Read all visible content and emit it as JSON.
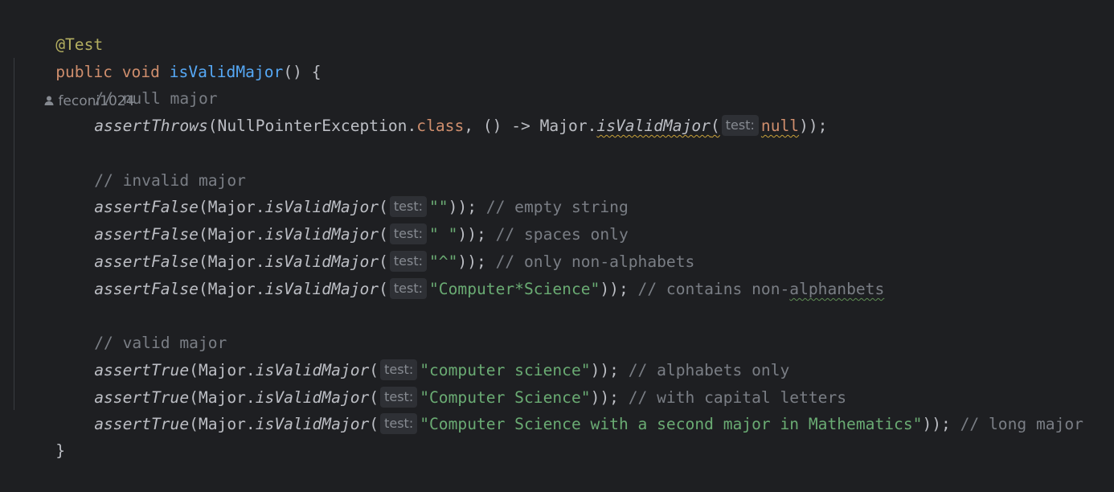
{
  "header": {
    "annotation": "@Test",
    "author": "feconi1024"
  },
  "method": {
    "keyword_public": "public",
    "keyword_void": "void",
    "name": "isValidMajor",
    "params_open": "() {",
    "close_brace": "}"
  },
  "hint_label": "test:",
  "comments": {
    "null_major": "// null major",
    "invalid_major": "// invalid major",
    "valid_major": "// valid major"
  },
  "lines": {
    "throws": {
      "assert": "assertThrows",
      "open": "(NullPointerException.",
      "class_kw": "class",
      "mid": ", () -> Major.",
      "call": "isValidMajor",
      "paren": "(",
      "arg": "null",
      "close": "));"
    },
    "invalid": [
      {
        "assert": "assertFalse",
        "pre": "(Major.",
        "call": "isValidMajor",
        "paren": "(",
        "arg": "\"\"",
        "close": "));",
        "comment": "// empty string"
      },
      {
        "assert": "assertFalse",
        "pre": "(Major.",
        "call": "isValidMajor",
        "paren": "(",
        "arg": "\" \"",
        "close": "));",
        "comment": "// spaces only"
      },
      {
        "assert": "assertFalse",
        "pre": "(Major.",
        "call": "isValidMajor",
        "paren": "(",
        "arg": "\"^\"",
        "close": "));",
        "comment": "// only non-alphabets"
      },
      {
        "assert": "assertFalse",
        "pre": "(Major.",
        "call": "isValidMajor",
        "paren": "(",
        "arg": "\"Computer*Science\"",
        "close": "));",
        "comment_a": "// contains non-",
        "comment_b": "alphanbets"
      }
    ],
    "valid": [
      {
        "assert": "assertTrue",
        "pre": "(Major.",
        "call": "isValidMajor",
        "paren": "(",
        "arg": "\"computer science\"",
        "close": "));",
        "comment": "// alphabets only"
      },
      {
        "assert": "assertTrue",
        "pre": "(Major.",
        "call": "isValidMajor",
        "paren": "(",
        "arg": "\"Computer Science\"",
        "close": "));",
        "comment": "// with capital letters"
      },
      {
        "assert": "assertTrue",
        "pre": "(Major.",
        "call": "isValidMajor",
        "paren": "(",
        "arg": "\"Computer Science with a second major in Mathematics\"",
        "close": "));",
        "comment": "// long major"
      }
    ]
  },
  "colors": {
    "background": "#1e1f22",
    "keyword": "#cf8e6d",
    "function": "#56a8f5",
    "string": "#6aab73",
    "comment": "#7a7e85",
    "annotation": "#b3ae60",
    "text": "#bcbec4"
  },
  "icons": {
    "author": "person-icon"
  }
}
